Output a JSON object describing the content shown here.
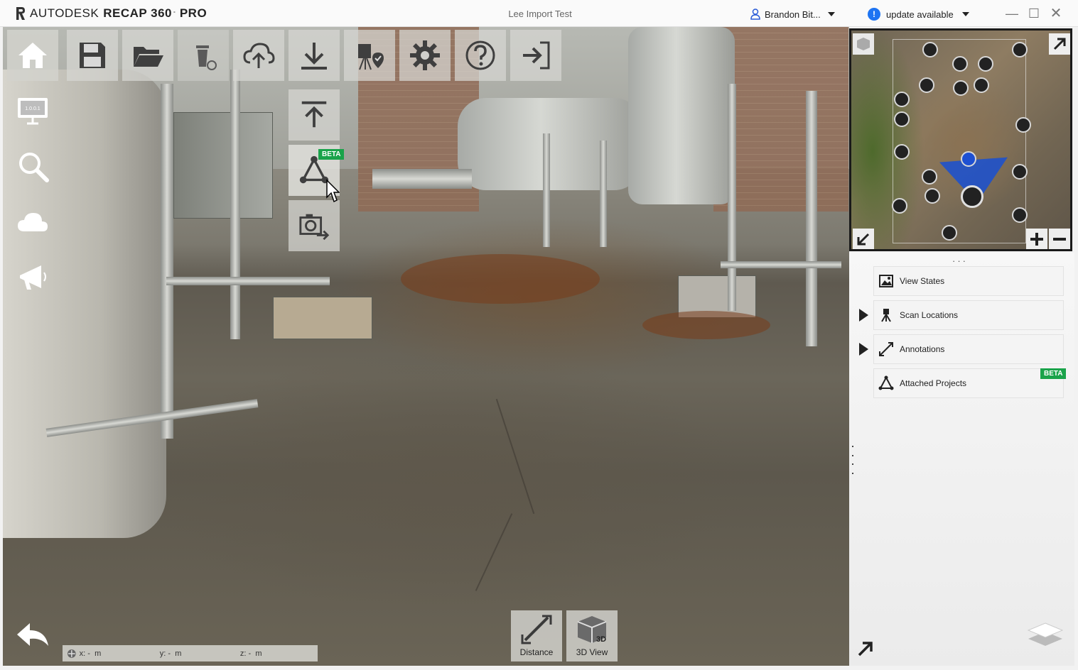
{
  "titlebar": {
    "brand": "AUTODESK",
    "product": "RECAP 360",
    "product_suffix": "PRO",
    "document_title": "Lee Import Test",
    "user_name": "Brandon Bit...",
    "update_text": "update available",
    "update_badge": "!"
  },
  "toolbar": {
    "items": [
      {
        "name": "home",
        "icon": "home-icon"
      },
      {
        "name": "save",
        "icon": "save-icon"
      },
      {
        "name": "open",
        "icon": "folder-open-icon"
      },
      {
        "name": "delete",
        "icon": "trash-restore-icon"
      },
      {
        "name": "upload",
        "icon": "cloud-upload-icon"
      },
      {
        "name": "export",
        "icon": "download-icon"
      },
      {
        "name": "scan-location",
        "icon": "camera-location-icon"
      },
      {
        "name": "settings",
        "icon": "gear-icon"
      },
      {
        "name": "help",
        "icon": "help-icon"
      },
      {
        "name": "exit",
        "icon": "exit-icon"
      }
    ],
    "submenu": [
      {
        "name": "import",
        "icon": "upload-arrow-icon"
      },
      {
        "name": "attach-project",
        "icon": "attach-project-icon",
        "badge": "BETA"
      },
      {
        "name": "snapshot",
        "icon": "camera-export-icon"
      }
    ]
  },
  "left_nav": [
    {
      "name": "display",
      "icon": "monitor-icon",
      "screen_text": "1.0.0.1"
    },
    {
      "name": "search",
      "icon": "search-icon"
    },
    {
      "name": "cloud",
      "icon": "cloud-icon"
    },
    {
      "name": "announce",
      "icon": "megaphone-icon"
    }
  ],
  "coords": {
    "x_label": "x:",
    "x_value": "-",
    "x_unit": "m",
    "y_label": "y:",
    "y_value": "-",
    "y_unit": "m",
    "z_label": "z:",
    "z_value": "-",
    "z_unit": "m"
  },
  "bottom_tools": {
    "distance_label": "Distance",
    "view3d_label": "3D View",
    "view3d_badge": "3D"
  },
  "right_panel": {
    "items": [
      {
        "label": "View States",
        "icon": "image-icon",
        "expandable": false
      },
      {
        "label": "Scan Locations",
        "icon": "tripod-icon",
        "expandable": true
      },
      {
        "label": "Annotations",
        "icon": "measure-icon",
        "expandable": true
      },
      {
        "label": "Attached Projects",
        "icon": "attach-project-icon",
        "expandable": false,
        "badge": "BETA"
      }
    ]
  },
  "colors": {
    "beta_green": "#1aa34a",
    "update_blue": "#1e74f2",
    "minimap_cone": "#1e50d2"
  }
}
